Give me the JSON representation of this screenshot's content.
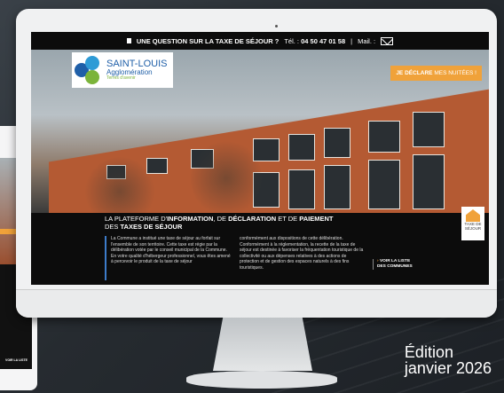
{
  "topbar": {
    "question": "UNE QUESTION SUR LA TAXE DE SÉJOUR ?",
    "tel_label": "Tél. :",
    "tel_number": "04 50 47 01 58",
    "separator": "|",
    "mail_label": "Mail. :"
  },
  "logo": {
    "line1": "SAINT-LOUIS",
    "line2": "Agglomération",
    "line3": "Terres d'avenir"
  },
  "declare_button": {
    "strong": "JE DÉCLARE",
    "rest": "MES NUITÉES !"
  },
  "taxe_badge": {
    "line1": "TAXE DE",
    "line2": "SÉJOUR"
  },
  "headline": {
    "p1": "LA PLATEFORME D'",
    "b1": "INFORMATION",
    "p2": ", DE ",
    "b2": "DÉCLARATION",
    "p3": " ET DE ",
    "b3": "PAIEMENT",
    "p4": "DES ",
    "b4": "TAXES DE SÉJOUR"
  },
  "col1": "La Commune  a institué une taxe de séjour au forfait sur l'ensemble de son territoire. Cette taxe est régie par la délibération votée par le conseil municipal de la Commune. En votre qualité d'hébergeur professionnel, vous êtes amené à percevoir le produit de la taxe de séjour",
  "col2": "conformément aux dispositions de cette délibération. Conformément à la réglementation, la recette de la taxe de séjour est destinée à favoriser la fréquentation touristique de la collectivité ou aux dépenses relatives à des actions de protection et de gestion des espaces naturels à des fins touristiques.",
  "voir": {
    "line1": "VOIR LA LISTE",
    "line2": "DES COMMUNES"
  },
  "edition": {
    "line1": "Édition",
    "line2": "janvier 2026"
  },
  "colors": {
    "accent": "#f0a23a",
    "brand": "#1f5fa8",
    "bar": "#3d7cc9"
  }
}
